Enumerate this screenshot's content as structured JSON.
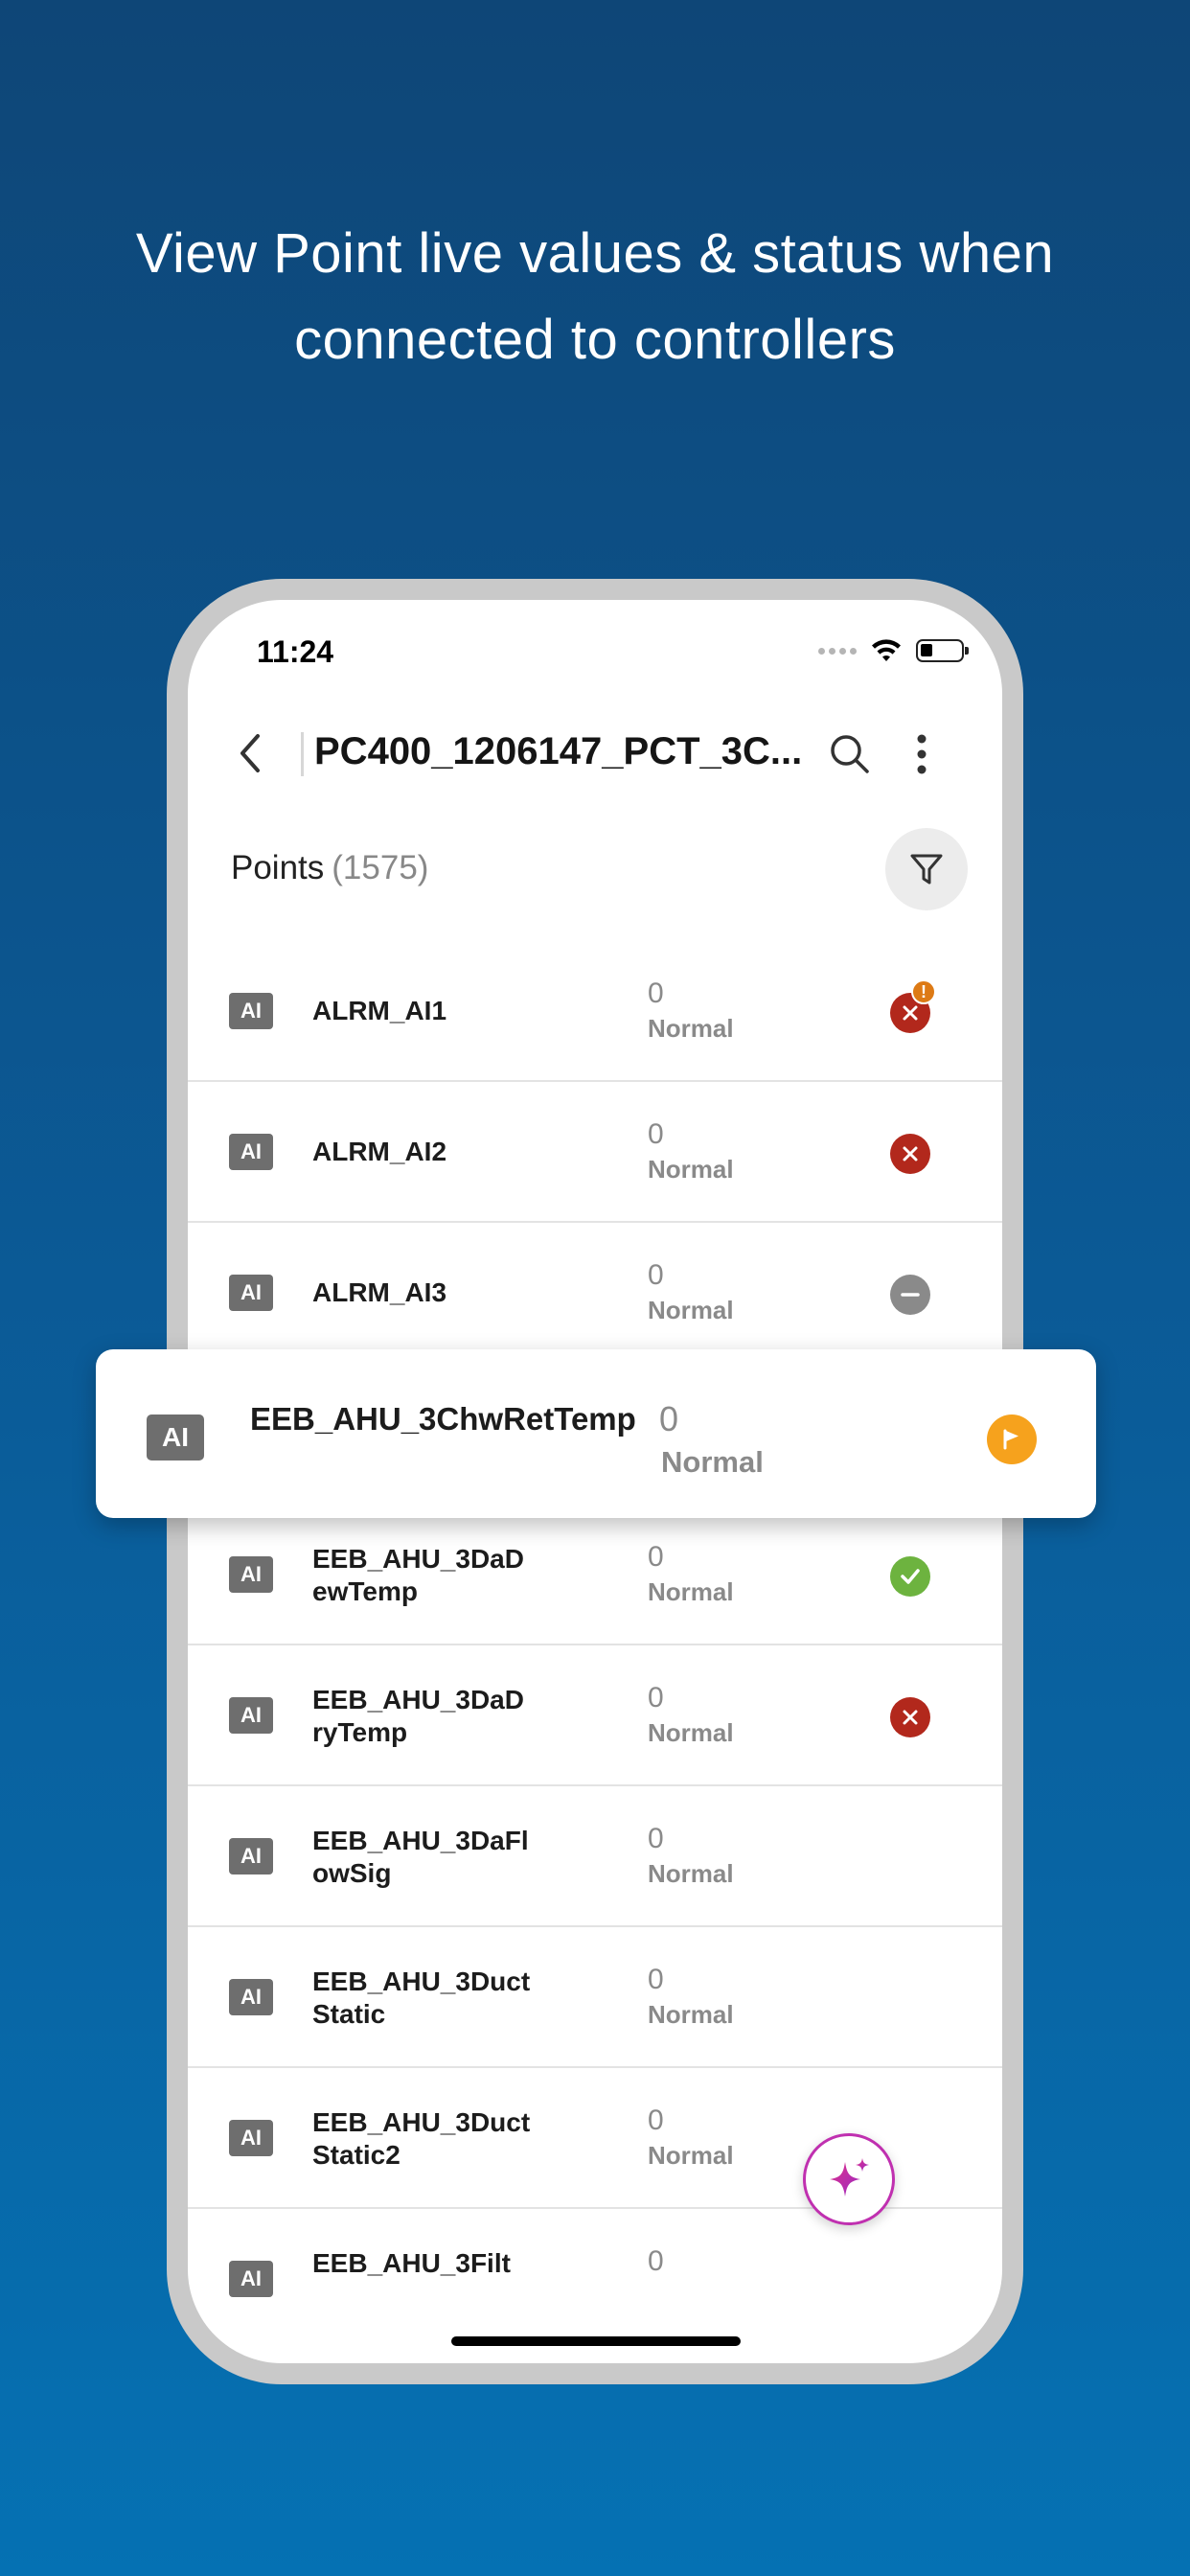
{
  "headline": {
    "line1": "View Point live values & status when",
    "line2": "connected to controllers"
  },
  "status_bar": {
    "time": "11:24"
  },
  "header": {
    "title": "PC400_1206147_PCT_3C..."
  },
  "points": {
    "label": "Points",
    "count": "(1575)"
  },
  "rows": [
    {
      "badge": "AI",
      "name": "ALRM_AI1",
      "value": "0",
      "status": "Normal",
      "icon": "error-alert-icon"
    },
    {
      "badge": "AI",
      "name": "ALRM_AI2",
      "value": "0",
      "status": "Normal",
      "icon": "error-icon"
    },
    {
      "badge": "AI",
      "name": "ALRM_AI3",
      "value": "0",
      "status": "Normal",
      "icon": "disabled-icon"
    },
    {
      "badge": "AI",
      "name": "EEB_AHU_3DaDewTemp",
      "value": "0",
      "status": "Normal",
      "icon": "ok-icon"
    },
    {
      "badge": "AI",
      "name": "EEB_AHU_3DaDryTemp",
      "value": "0",
      "status": "Normal",
      "icon": "error-icon"
    },
    {
      "badge": "AI",
      "name": "EEB_AHU_3DaFlowSig",
      "value": "0",
      "status": "Normal",
      "icon": "none"
    },
    {
      "badge": "AI",
      "name": "EEB_AHU_3DuctStatic",
      "value": "0",
      "status": "Normal",
      "icon": "none"
    },
    {
      "badge": "AI",
      "name": "EEB_AHU_3DuctStatic2",
      "value": "0",
      "status": "Normal",
      "icon": "none"
    },
    {
      "badge": "AI",
      "name": "EEB_AHU_3Filt",
      "value": "0",
      "status": "",
      "icon": "none"
    }
  ],
  "highlight": {
    "badge": "AI",
    "name": "EEB_AHU_3ChwRetTemp",
    "value": "0",
    "status": "Normal",
    "icon": "flag-icon"
  },
  "colors": {
    "error": "#b2281c",
    "ok": "#6db33f",
    "disabled": "#8a8a8a",
    "alert": "#dd7a15",
    "flag": "#f6a21d",
    "fab_accent": "#c030b0"
  }
}
